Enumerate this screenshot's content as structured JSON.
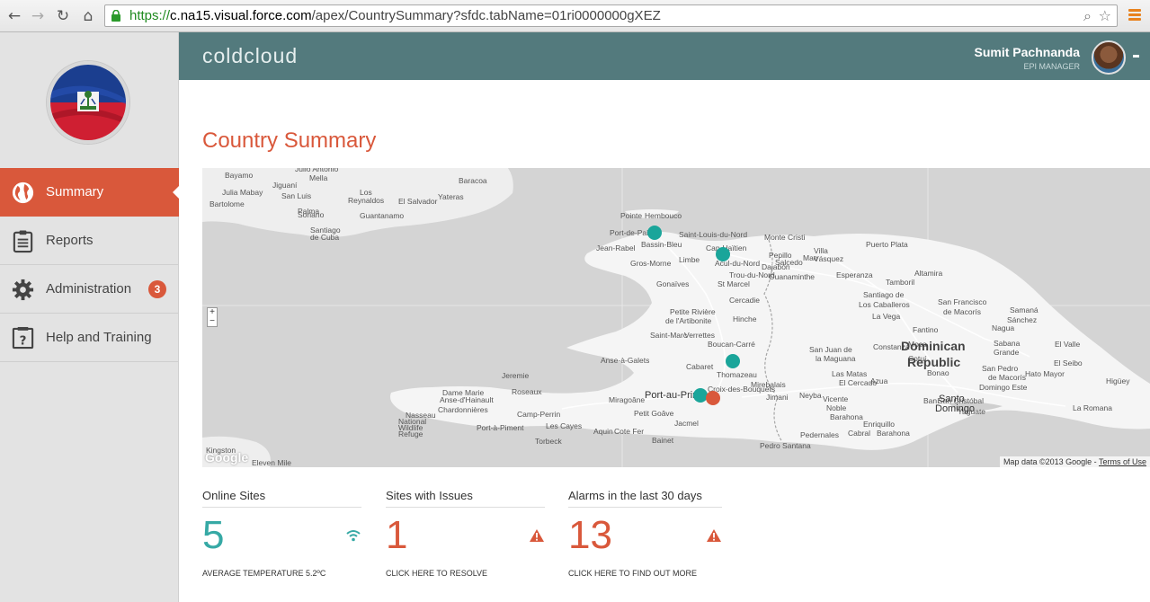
{
  "browser": {
    "url_scheme": "https://",
    "url_host": "c.na15.visual.force.com",
    "url_path": "/apex/CountrySummary?sfdc.tabName=01ri0000000gXEZ"
  },
  "header": {
    "brand": "coldcloud",
    "user_name": "Sumit Pachnanda",
    "user_role": "EPI MANAGER"
  },
  "sidebar": {
    "items": [
      {
        "label": "Summary",
        "icon": "globe-icon",
        "active": true
      },
      {
        "label": "Reports",
        "icon": "clipboard-icon"
      },
      {
        "label": "Administration",
        "icon": "gear-icon",
        "badge": "3"
      },
      {
        "label": "Help and Training",
        "icon": "help-icon"
      }
    ]
  },
  "main": {
    "title": "Country Summary"
  },
  "map": {
    "credit": "Map data ©2013 Google",
    "credit_sep": " - ",
    "terms": "Terms of Use",
    "google": "Google",
    "labels": [
      "Bayamo",
      "Julio Antonio",
      "Mella",
      "Baracoa",
      "Jiguaní",
      "Los",
      "Reynaldos",
      "El Salvador",
      "Julia Mabay",
      "San Luis",
      "Yateras",
      "Bartolome",
      "Palma",
      "Soriano",
      "Guantanamo",
      "Santiago",
      "de Cuba",
      "Hembouco",
      "Pointe",
      "Port-de-Paix",
      "Cap-Haïtien",
      "Saint-Louis-du-Nord",
      "Bassin-Bleu",
      "Jean-Rabel",
      "Limbe",
      "Gros-Morne",
      "Acul-du-Nord",
      "Trou-du-Nord",
      "Gonaïves",
      "St Marcel",
      "Cercadie",
      "Petite Rivière",
      "de l'Artibonite",
      "Hinche",
      "Saint-Marc",
      "Verrettes",
      "Boucan-Carré",
      "Anse-à-Galets",
      "Cabaret",
      "Thomazeau",
      "Port-au-Prince",
      "Croix-des-Bouquets",
      "Jeremie",
      "Roseaux",
      "Dame Marie",
      "Anse-d'Hainault",
      "Chardonnières",
      "Miragoâne",
      "Petit Goâve",
      "Jacmel",
      "Les Cayes",
      "Torbeck",
      "Bainet",
      "Kingston",
      "Eleven Mile",
      "Monte Cristi",
      "Puerto Plata",
      "Santiago de",
      "Los Caballeros",
      "La Vega",
      "San Francisco",
      "de Macorís",
      "Dominican",
      "Republic",
      "Constanza",
      "San Juan de",
      "la Maguana",
      "Azua",
      "Barahona",
      "Santo",
      "Domingo",
      "Santo",
      "Domingo Este",
      "San Pedro",
      "de Macorís",
      "La Romana",
      "Higüey",
      "El Seibo",
      "Hato Mayor",
      "El Valle",
      "Samaná",
      "Nagua",
      "Cotuí",
      "Bonao",
      "Baní",
      "Neyba",
      "Jimani",
      "Vicente",
      "Noble",
      "Pedernales",
      "Enriquillo",
      "Dajabón",
      "Mao",
      "Sánchez",
      "Fantino",
      "Tamboril",
      "Altamira",
      "San Cristóbal",
      "Yaguate",
      "Ouanaminthe",
      "Pepillo",
      "Salcedo",
      "Villa",
      "Vásquez",
      "Esperanza",
      "Moca",
      "Sabana",
      "Grande",
      "Nasseau",
      "National",
      "Wildlife",
      "Refuge",
      "Camp-Perrin",
      "Port-à-Piment",
      "Aquin",
      "Cote Fer",
      "Mirebalais",
      "Pedro Santana",
      "Las Matas",
      "El Cercado",
      "Cabral",
      "Barahona"
    ],
    "markers": [
      {
        "status": "online"
      },
      {
        "status": "online"
      },
      {
        "status": "online"
      },
      {
        "status": "online"
      },
      {
        "status": "alarm"
      }
    ]
  },
  "stats": [
    {
      "label": "Online Sites",
      "value": "5",
      "sub": "AVERAGE TEMPERATURE 5.2ºC",
      "icon": "wifi-icon",
      "color": "#36a9a5"
    },
    {
      "label": "Sites with Issues",
      "value": "1",
      "sub": "CLICK HERE TO RESOLVE",
      "icon": "warning-icon",
      "color": "#d9583b"
    },
    {
      "label": "Alarms in the last 30 days",
      "value": "13",
      "sub": "CLICK HERE TO FIND OUT MORE",
      "icon": "warning-icon",
      "color": "#d9583b"
    }
  ],
  "colors": {
    "accent": "#d9583b",
    "teal": "#36a9a5",
    "topbar": "#537a7d"
  }
}
